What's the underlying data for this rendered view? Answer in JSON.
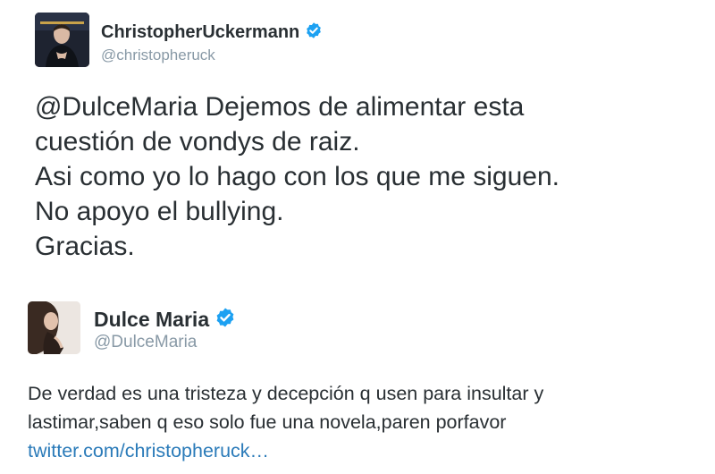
{
  "tweets": [
    {
      "display_name": "ChristopherUckermann",
      "handle": "@christopheruck",
      "verified": true,
      "lines": [
        "@DulceMaria Dejemos de alimentar esta",
        "cuestión de vondys de raiz.",
        "Asi como yo lo hago con los que me siguen.",
        "No apoyo el bullying.",
        "Gracias."
      ]
    },
    {
      "display_name": "Dulce Maria",
      "handle": "@DulceMaria",
      "verified": true,
      "lines": [
        "De verdad es una tristeza y decepción q usen para insultar y",
        "lastimar,saben q eso solo fue una novela,paren porfavor"
      ],
      "link": "twitter.com/christopheruck…"
    }
  ],
  "colors": {
    "text": "#292f33",
    "handle": "#8899a6",
    "link": "#2b7bb9",
    "verified": "#1da1f2"
  },
  "icons": {
    "verified": "verified-badge-icon"
  }
}
